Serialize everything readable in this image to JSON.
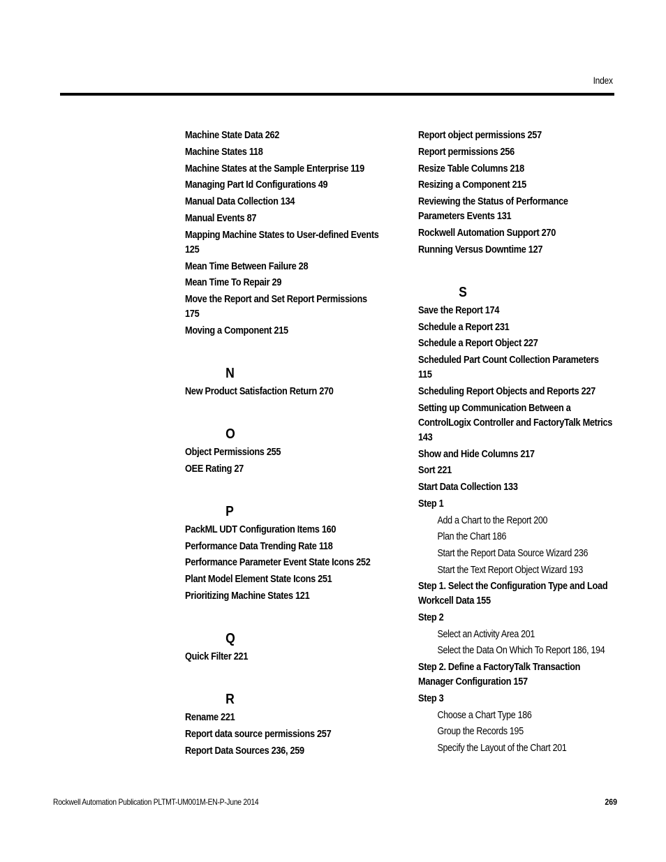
{
  "header": {
    "section_label": "Index"
  },
  "left_column": {
    "entries_m": [
      "Machine State Data 262",
      "Machine States 118",
      "Machine States at the Sample Enterprise 119",
      "Managing Part Id Configurations 49",
      "Manual Data Collection 134",
      "Manual Events 87",
      "Mapping Machine States to User-defined Events 125",
      "Mean Time Between Failure 28",
      "Mean Time To Repair 29",
      "Move the Report and Set Report Permissions 175",
      "Moving a Component 215"
    ],
    "heading_n": "N",
    "entries_n": [
      "New Product Satisfaction Return 270"
    ],
    "heading_o": "O",
    "entries_o": [
      "Object Permissions 255",
      "OEE Rating 27"
    ],
    "heading_p": "P",
    "entries_p": [
      "PackML UDT Configuration Items 160",
      "Performance Data Trending Rate 118",
      "Performance Parameter Event State Icons 252",
      "Plant Model Element State Icons 251",
      "Prioritizing Machine States 121"
    ],
    "heading_q": "Q",
    "entries_q": [
      "Quick Filter 221"
    ],
    "heading_r": "R",
    "entries_r": [
      "Rename 221",
      "Report data source permissions 257",
      "Report Data Sources 236, 259"
    ]
  },
  "right_column": {
    "entries_r_cont": [
      "Report object permissions 257",
      "Report permissions 256",
      "Resize Table Columns 218",
      "Resizing a Component 215",
      "Reviewing the Status of Performance Parameters Events 131",
      "Rockwell Automation Support 270",
      "Running Versus Downtime 127"
    ],
    "heading_s": "S",
    "entries_s": [
      "Save the Report 174",
      "Schedule a Report 231",
      "Schedule a Report Object 227",
      "Scheduled Part Count Collection Parameters 115",
      "Scheduling Report Objects and Reports 227",
      "Setting up Communication Between a ControlLogix Controller and FactoryTalk Metrics 143",
      "Show and Hide Columns 217",
      "Sort 221",
      "Start Data Collection 133"
    ],
    "step1": {
      "label": "Step 1",
      "subentries": [
        "Add a Chart to the Report 200",
        "Plan the Chart 186",
        "Start the Report Data Source Wizard 236",
        "Start the Text Report Object Wizard 193"
      ]
    },
    "step1_select": "Step 1. Select the Configuration Type and Load Workcell Data 155",
    "step2": {
      "label": "Step 2",
      "subentries": [
        "Select an Activity Area 201",
        "Select the Data On Which To Report 186, 194"
      ]
    },
    "step2_define": "Step 2. Define a FactoryTalk Transaction Manager Configuration 157",
    "step3": {
      "label": "Step 3",
      "subentries": [
        "Choose a Chart Type 186",
        "Group the Records 195",
        "Specify the Layout of the Chart 201"
      ]
    }
  },
  "footer": {
    "publication": "Rockwell Automation Publication PLTMT-UM001M-EN-P-June 2014",
    "page_number": "269"
  }
}
